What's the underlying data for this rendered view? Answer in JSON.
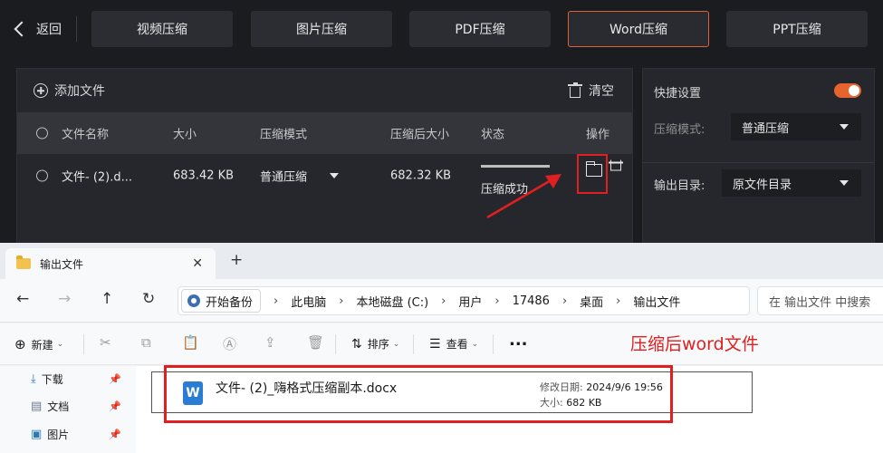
{
  "topbar": {
    "back_label": "返回",
    "tabs": [
      {
        "label": "视频压缩"
      },
      {
        "label": "图片压缩"
      },
      {
        "label": "PDF压缩"
      },
      {
        "label": "Word压缩"
      },
      {
        "label": "PPT压缩"
      }
    ],
    "active_tab": "Word压缩",
    "accent": "#e0603a"
  },
  "file_panel": {
    "add_label": "添加文件",
    "clear_label": "清空",
    "columns": [
      "文件名称",
      "大小",
      "压缩模式",
      "压缩后大小",
      "状态",
      "操作"
    ],
    "rows": [
      {
        "name": "文件- (2).d...",
        "size": "683.42 KB",
        "mode": "普通压缩",
        "compressed_size": "682.32 KB",
        "status": "压缩成功",
        "progress": 1.0
      }
    ]
  },
  "quick_settings": {
    "title": "快捷设置",
    "toggle_on": true,
    "mode_label": "压缩模式:",
    "mode_value": "普通压缩",
    "output_label": "输出目录:",
    "output_value": "原文件目录"
  },
  "explorer": {
    "tab_title": "输出文件",
    "breadcrumb": [
      "开始备份",
      "此电脑",
      "本地磁盘 (C:)",
      "用户",
      "17486",
      "桌面",
      "输出文件"
    ],
    "search_placeholder": "在 输出文件 中搜索",
    "commands": {
      "new": "新建",
      "sort": "排序",
      "view": "查看",
      "more": "..."
    },
    "sidebar": [
      {
        "label": "下载",
        "icon": "download-icon"
      },
      {
        "label": "文档",
        "icon": "document-icon"
      },
      {
        "label": "图片",
        "icon": "picture-icon"
      }
    ],
    "file": {
      "name": "文件- (2)_嗨格式压缩副本.docx",
      "modified_label": "修改日期:",
      "modified_value": "2024/9/6 19:56",
      "size_label": "大小:",
      "size_value": "682 KB"
    }
  },
  "annotation": {
    "text": "压缩后word文件",
    "color": "#e02020"
  }
}
